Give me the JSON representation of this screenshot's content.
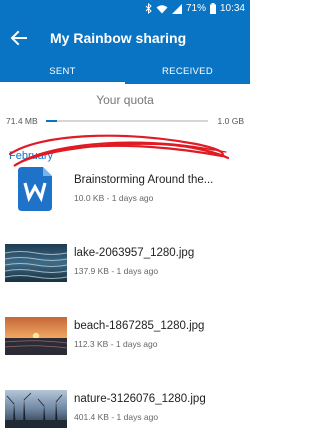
{
  "status_bar": {
    "battery": "71%",
    "time": "10:34"
  },
  "app_bar": {
    "title": "My Rainbow sharing"
  },
  "tabs": [
    {
      "label": "SENT",
      "selected": true
    },
    {
      "label": "RECEIVED",
      "selected": false
    }
  ],
  "quota": {
    "title": "Your quota",
    "used": "71.4 MB",
    "total": "1.0 GB",
    "fill_fraction": 0.07
  },
  "section": {
    "label": "February"
  },
  "files": [
    {
      "name": "Brainstorming Around the...",
      "meta": "10.0 KB - 1 days ago",
      "icon": "word-document-icon"
    },
    {
      "name": "lake-2063957_1280.jpg",
      "meta": "137.9 KB - 1 days ago",
      "icon": "lake-thumbnail"
    },
    {
      "name": "beach-1867285_1280.jpg",
      "meta": "112.3 KB - 1 days ago",
      "icon": "beach-thumbnail"
    },
    {
      "name": "nature-3126076_1280.jpg",
      "meta": "401.4 KB - 1 days ago",
      "icon": "nature-thumbnail"
    }
  ],
  "colors": {
    "primary": "#0a74c4",
    "annotation": "#e01b24"
  }
}
